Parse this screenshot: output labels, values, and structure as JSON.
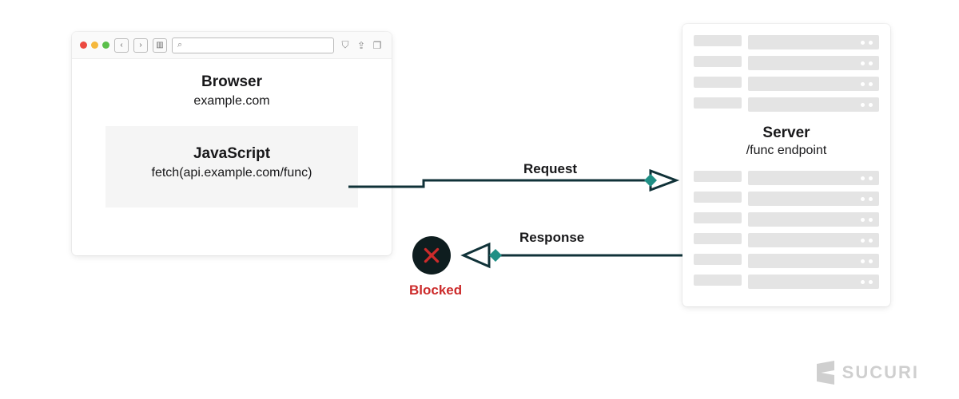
{
  "browser": {
    "title": "Browser",
    "domain": "example.com",
    "js_title": "JavaScript",
    "js_call": "fetch(api.example.com/func)",
    "search_placeholder": ""
  },
  "server": {
    "title": "Server",
    "endpoint": "/func endpoint"
  },
  "labels": {
    "request": "Request",
    "response": "Response",
    "blocked": "Blocked"
  },
  "brand": "SUCURI",
  "colors": {
    "line": "#103238",
    "accent": "#1f8f85",
    "blocked": "#cc2b2b"
  }
}
